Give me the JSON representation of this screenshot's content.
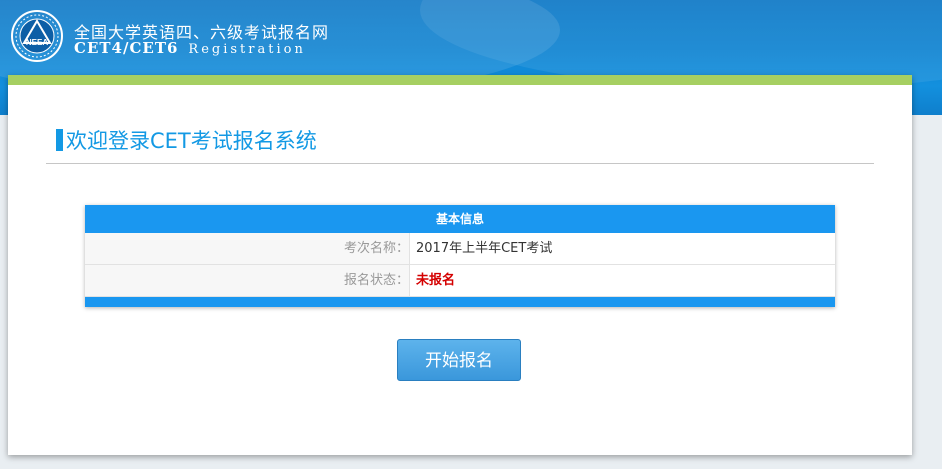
{
  "header": {
    "logo_text": "NEEA",
    "title_cn": "全国大学英语四、六级考试报名网",
    "title_en": "CET4/CET6",
    "title_reg": "Registration"
  },
  "main": {
    "welcome": "欢迎登录CET考试报名系统",
    "info": {
      "heading": "基本信息",
      "rows": [
        {
          "label": "考次名称：",
          "value": "2017年上半年CET考试"
        },
        {
          "label": "报名状态：",
          "value": "未报名"
        }
      ]
    },
    "start_button": "开始报名"
  },
  "colors": {
    "accent": "#1a97f0",
    "green_strip": "#a6cf62",
    "status_red": "#d40000"
  }
}
